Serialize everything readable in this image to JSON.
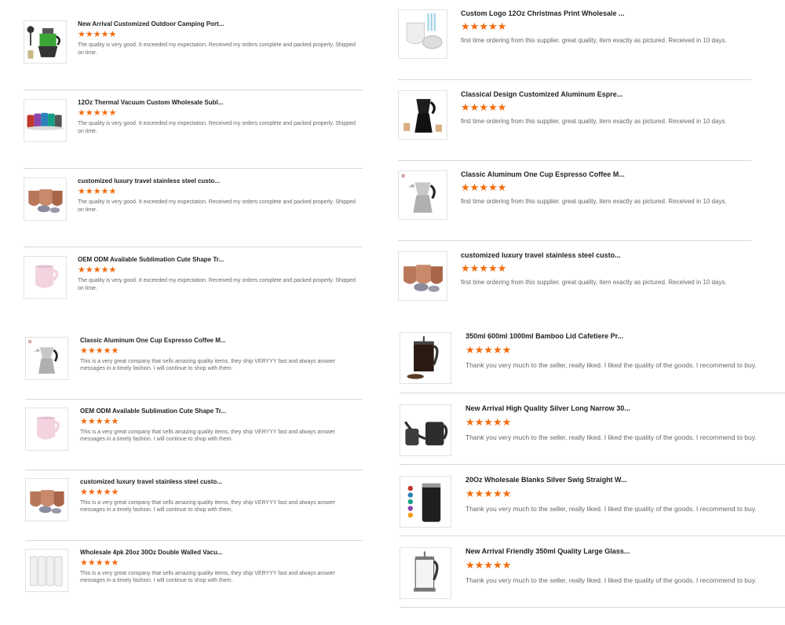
{
  "stars": "★★★★★",
  "accent": "#f26b0c",
  "comments": {
    "a": "The quality is very good. It exceeded my expectation. Received my orders complete and packed properly. Shipped on time.",
    "b": "This is a very great company that sells amazing quality items, they ship VERYYY fast and always answer messages in a timely fashion. I will continue to shop with them.",
    "c": "first time ordering from this supplier. great quality, item exactly as pictured. Received in 10 days.",
    "d": "Thank you very much to the seller, really liked.  I liked the quality of the goods. I recommend to buy."
  },
  "left_reviews": [
    {
      "title": "New Arrival Customized Outdoor Camping Port...",
      "image": "moka-pot-green-icon"
    },
    {
      "title": "12Oz Thermal Vacuum Custom Wholesale Subl...",
      "image": "colorful-cups-icon"
    },
    {
      "title": "customized luxury travel stainless steel custo...",
      "image": "copper-tumblers-icon"
    },
    {
      "title": "OEM ODM Available Sublimation Cute Shape Tr...",
      "image": "pink-mug-icon"
    },
    {
      "title": "Classic Aluminum One Cup Espresso Coffee M...",
      "image": "silver-moka-pot-icon"
    },
    {
      "title": "OEM ODM Available Sublimation Cute Shape Tr...",
      "image": "pink-mug-icon"
    },
    {
      "title": "customized luxury travel stainless steel custo...",
      "image": "copper-tumblers-icon"
    },
    {
      "title": "Wholesale 4pk 20oz 30Oz Double Walled Vacu...",
      "image": "white-tumblers-icon"
    }
  ],
  "right_reviews": [
    {
      "title": "Custom Logo 12Oz Christmas Print Wholesale ...",
      "image": "white-cup-lid-icon"
    },
    {
      "title": "Classical Design Customized Aluminum Espre...",
      "image": "black-moka-pot-icon"
    },
    {
      "title": "Classic Aluminum One Cup Espresso Coffee M...",
      "image": "silver-moka-pot-icon"
    },
    {
      "title": "customized luxury travel stainless steel custo...",
      "image": "copper-tumblers-icon"
    },
    {
      "title": "350ml 600ml 1000ml Bamboo Lid Cafetiere Pr...",
      "image": "french-press-icon"
    },
    {
      "title": "New Arrival High Quality Silver Long Narrow 30...",
      "image": "gooseneck-kettle-icon"
    },
    {
      "title": "20Oz Wholesale Blanks Silver Swig Straight W...",
      "image": "black-tumbler-icon"
    },
    {
      "title": "New Arrival Friendly 350ml Quality Large Glass...",
      "image": "glass-french-press-icon"
    }
  ]
}
